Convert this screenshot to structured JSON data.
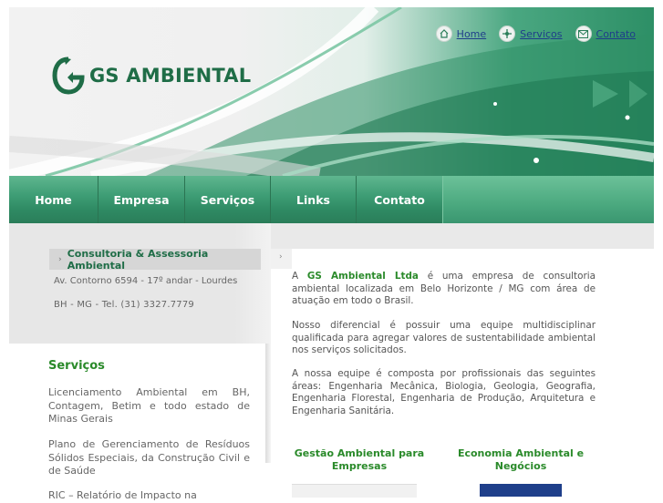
{
  "brand": {
    "name": "GS AMBIENTAL",
    "colors": {
      "primary_green": "#1f6d47",
      "menu_green": "#3f9e76",
      "link_blue": "#1f3e8a",
      "heading_green": "#2a8a2a"
    }
  },
  "top_links": [
    {
      "label": "Home",
      "icon": "home-icon"
    },
    {
      "label": "Serviços",
      "icon": "services-icon"
    },
    {
      "label": "Contato",
      "icon": "mail-icon"
    }
  ],
  "menu": [
    {
      "label": "Home"
    },
    {
      "label": "Empresa"
    },
    {
      "label": "Serviços"
    },
    {
      "label": "Links"
    },
    {
      "label": "Contato"
    }
  ],
  "breadcrumb": "Consultoria & Assessoria Ambiental",
  "address": {
    "line1": "Av. Contorno 6594 - 17º andar - Lourdes",
    "line2": "BH - MG - Tel. (31) 3327.7779"
  },
  "sidebar": {
    "title": "Serviços",
    "items": [
      "Licenciamento Ambiental em BH, Contagem, Betim e todo estado de Minas Gerais",
      "Plano de Gerenciamento de Resíduos Sólidos Especiais, da Construção Civil e de Saúde",
      "RIC – Relatório de Impacto na"
    ]
  },
  "main": {
    "intro_prefix": "A",
    "company": "GS Ambiental Ltda",
    "intro_rest": "é uma empresa de consultoria ambiental localizada em Belo Horizonte / MG com área de atuação em todo o Brasil.",
    "para2": "Nosso diferencial é possuir uma equipe multidisciplinar qualificada para agregar valores de sustentabilidade ambiental nos serviços solicitados.",
    "para3": "A nossa equipe é composta por profissionais das seguintes áreas: Engenharia Mecânica, Biologia, Geologia, Geografia, Engenharia Florestal, Engenharia de Produção, Arquitetura e Engenharia Sanitária.",
    "col1_title": "Gestão Ambiental para Empresas",
    "col2_title": "Economia Ambiental e Negócios"
  }
}
